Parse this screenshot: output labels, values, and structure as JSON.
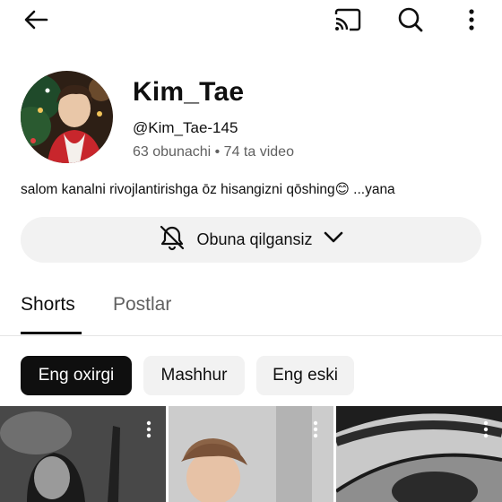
{
  "topbar": {
    "icons": [
      "back-arrow-icon",
      "cast-icon",
      "search-icon",
      "more-vert-icon"
    ]
  },
  "channel": {
    "name": "Kim_Tae",
    "handle": "@Kim_Tae-145",
    "stats": "63 obunachi • 74 ta video",
    "description": "salom kanalni rivojlantirishga ōz hisangizni qōshing",
    "description_emoji": "😊",
    "description_more": " ...yana"
  },
  "subscribe": {
    "label": "Obuna qilgansiz",
    "icon": "bell-icon",
    "chevron": "chevron-down-icon"
  },
  "tabs": [
    {
      "label": "Shorts",
      "active": true
    },
    {
      "label": "Postlar",
      "active": false
    }
  ],
  "chips": [
    {
      "label": "Eng oxirgi",
      "selected": true
    },
    {
      "label": "Mashhur",
      "selected": false
    },
    {
      "label": "Eng eski",
      "selected": false
    }
  ],
  "colors": {
    "text": "#0f0f0f",
    "secondary": "#606060",
    "chip_bg": "#f2f2f2",
    "chip_selected": "#0f0f0f"
  }
}
